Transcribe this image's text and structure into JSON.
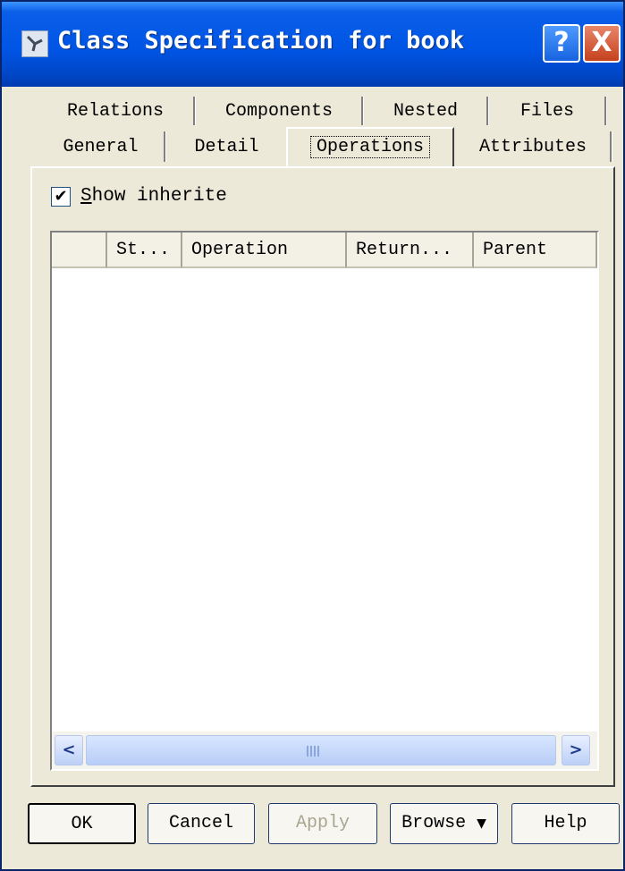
{
  "window": {
    "title": "Class Specification for book",
    "help_button": "?",
    "close_button": "X"
  },
  "tabs": {
    "back_row": [
      "Relations",
      "Components",
      "Nested",
      "Files"
    ],
    "front_row": [
      "General",
      "Detail",
      "Operations",
      "Attributes"
    ],
    "active": "Operations"
  },
  "operations_panel": {
    "show_inherited_checked": true,
    "show_inherited_prefix": "S",
    "show_inherited_rest": "how inherite",
    "columns": [
      "",
      "St...",
      "Operation",
      "Return...",
      "Parent"
    ],
    "rows": []
  },
  "scrollbar": {
    "left_arrow": "<",
    "right_arrow": ">"
  },
  "buttons": {
    "ok": "OK",
    "cancel": "Cancel",
    "apply": "Apply",
    "browse": "Browse",
    "browse_arrow": "▼",
    "help": "Help"
  }
}
